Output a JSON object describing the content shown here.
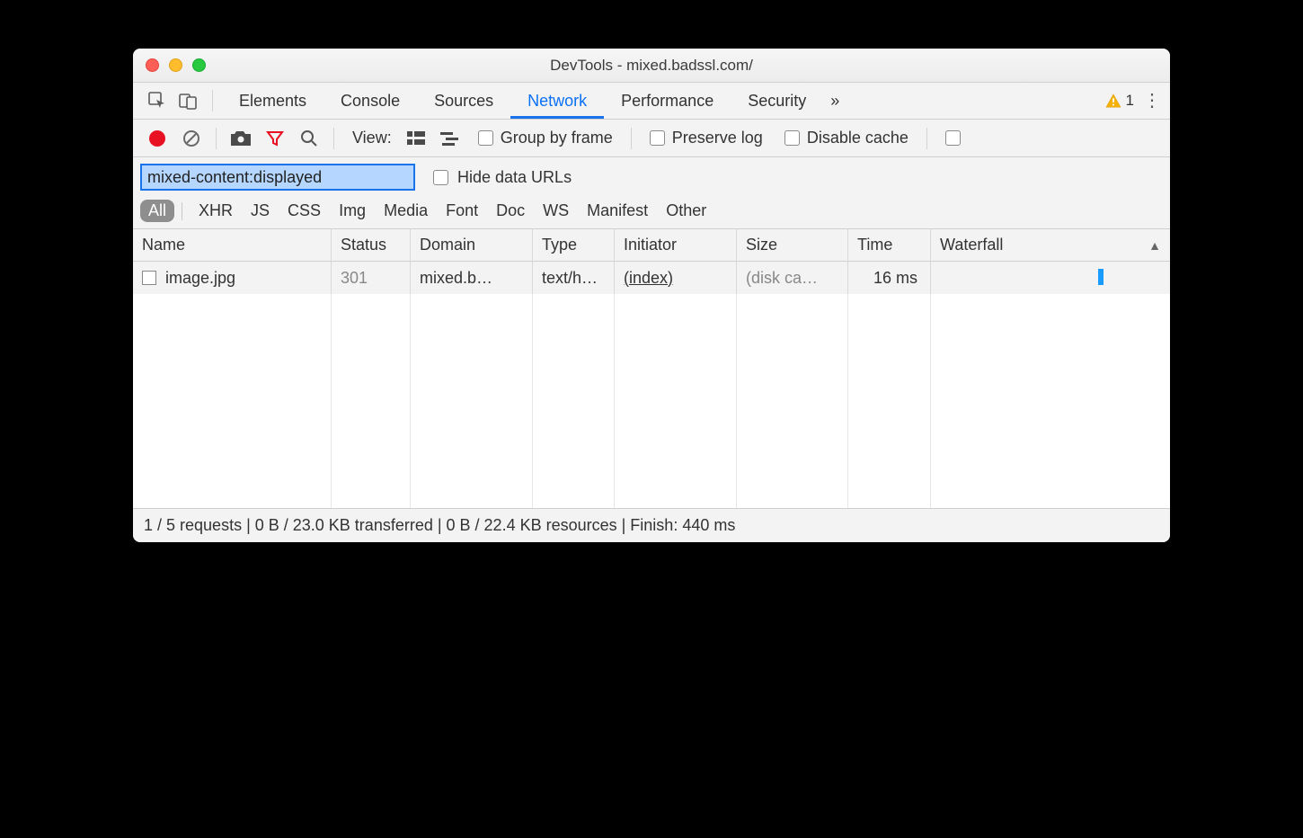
{
  "window": {
    "title": "DevTools - mixed.badssl.com/"
  },
  "tabs": {
    "items": [
      "Elements",
      "Console",
      "Sources",
      "Network",
      "Performance",
      "Security"
    ],
    "active_index": 3,
    "warning_count": "1"
  },
  "toolbar": {
    "view_label": "View:",
    "group_by_frame": "Group by frame",
    "preserve_log": "Preserve log",
    "disable_cache": "Disable cache"
  },
  "filter": {
    "value": "mixed-content:displayed",
    "hide_data_urls": "Hide data URLs",
    "types": {
      "all": "All",
      "items": [
        "XHR",
        "JS",
        "CSS",
        "Img",
        "Media",
        "Font",
        "Doc",
        "WS",
        "Manifest",
        "Other"
      ]
    }
  },
  "table": {
    "columns": [
      "Name",
      "Status",
      "Domain",
      "Type",
      "Initiator",
      "Size",
      "Time",
      "Waterfall"
    ],
    "rows": [
      {
        "name": "image.jpg",
        "status": "301",
        "domain": "mixed.b…",
        "type": "text/h…",
        "initiator": "(index)",
        "size": "(disk ca…",
        "time": "16 ms"
      }
    ]
  },
  "status": {
    "text": "1 / 5 requests | 0 B / 23.0 KB transferred | 0 B / 22.4 KB resources | Finish: 440 ms"
  }
}
